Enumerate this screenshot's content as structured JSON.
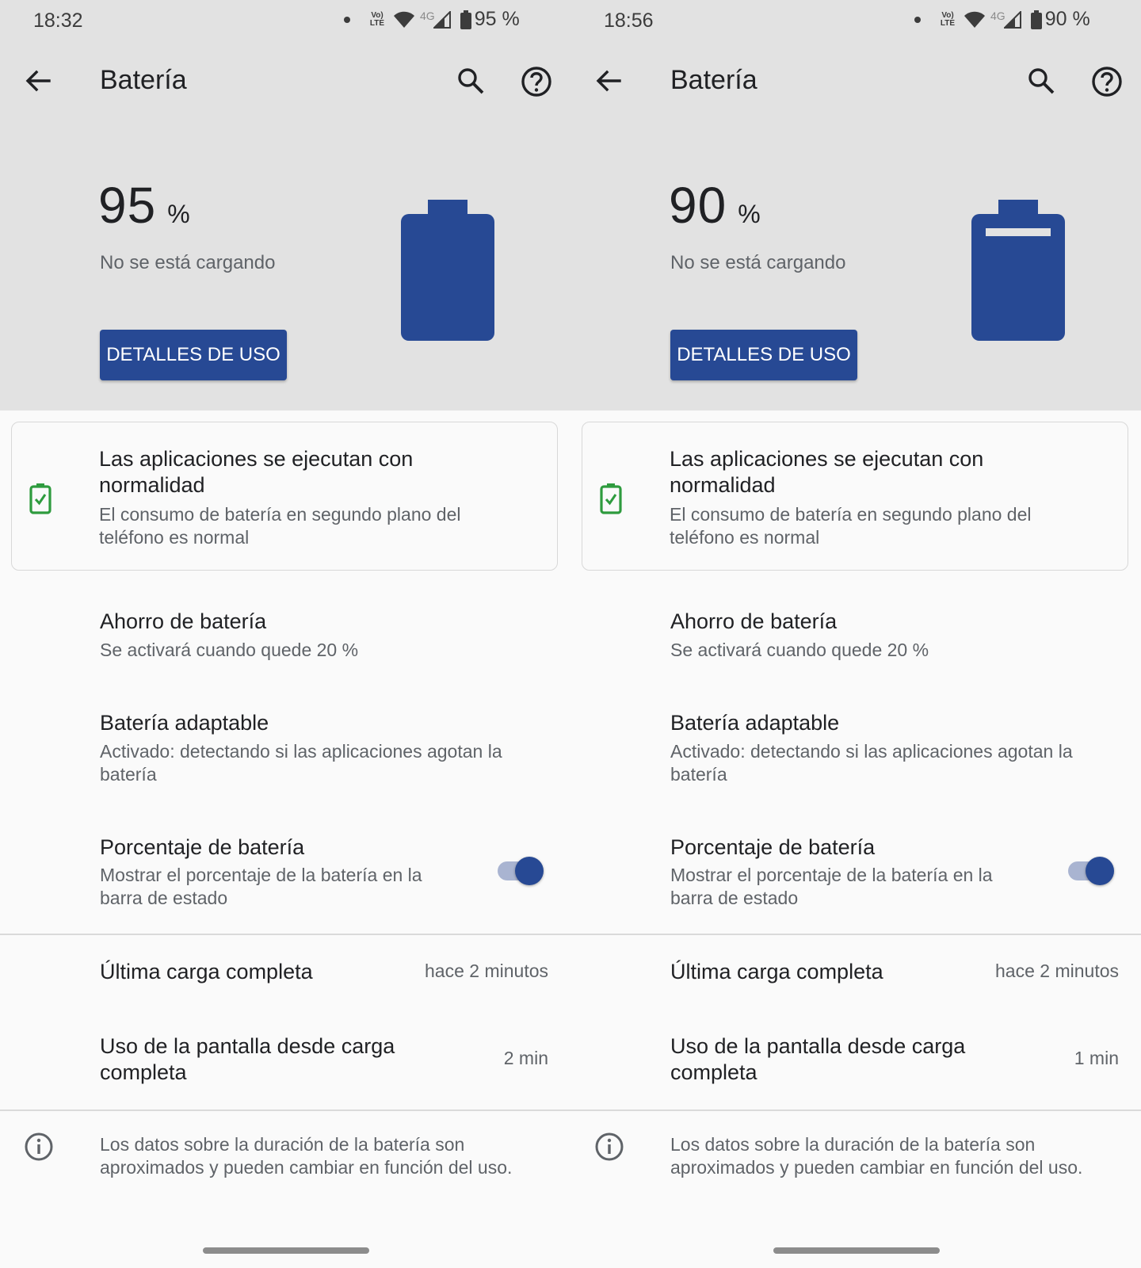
{
  "colors": {
    "accent": "#274994",
    "header_background": "#e2e2e2",
    "ok_green": "#2e9b3e"
  },
  "screens": [
    {
      "status": {
        "time": "18:32",
        "battery": "95 %"
      },
      "toolbar": {
        "title": "Batería",
        "back_icon": "arrow-back-icon",
        "search_icon": "search-icon",
        "help_icon": "help-icon"
      },
      "battery": {
        "percent": "95",
        "unit": "%",
        "state": "No se está cargando",
        "details_button": "DETALLES DE USO",
        "level": 0.95
      },
      "tip": {
        "title": "Las aplicaciones se ejecutan con normalidad",
        "summary": "El consumo de batería en segundo plano del teléfono es normal",
        "icon": "battery-check-icon"
      },
      "saver": {
        "title": "Ahorro de batería",
        "summary": "Se activará cuando quede 20 %"
      },
      "adaptive": {
        "title": "Batería adaptable",
        "summary": "Activado: detectando si las aplicaciones agotan la batería"
      },
      "percentage": {
        "title": "Porcentaje de batería",
        "summary": "Mostrar el porcentaje de la batería en la barra de estado",
        "enabled": true
      },
      "last_charge": {
        "label": "Última carga completa",
        "value": "hace 2 minutos"
      },
      "screen_usage": {
        "label": "Uso de la pantalla desde carga completa",
        "value": "2 min"
      },
      "footer": "Los datos sobre la duración de la batería son aproximados y pueden cambiar en función del uso."
    },
    {
      "status": {
        "time": "18:56",
        "battery": "90 %"
      },
      "toolbar": {
        "title": "Batería",
        "back_icon": "arrow-back-icon",
        "search_icon": "search-icon",
        "help_icon": "help-icon"
      },
      "battery": {
        "percent": "90",
        "unit": "%",
        "state": "No se está cargando",
        "details_button": "DETALLES DE USO",
        "level": 0.9
      },
      "tip": {
        "title": "Las aplicaciones se ejecutan con normalidad",
        "summary": "El consumo de batería en segundo plano del teléfono es normal",
        "icon": "battery-check-icon"
      },
      "saver": {
        "title": "Ahorro de batería",
        "summary": "Se activará cuando quede 20 %"
      },
      "adaptive": {
        "title": "Batería adaptable",
        "summary": "Activado: detectando si las aplicaciones agotan la batería"
      },
      "percentage": {
        "title": "Porcentaje de batería",
        "summary": "Mostrar el porcentaje de la batería en la barra de estado",
        "enabled": true
      },
      "last_charge": {
        "label": "Última carga completa",
        "value": "hace 2 minutos"
      },
      "screen_usage": {
        "label": "Uso de la pantalla desde carga completa",
        "value": "1 min"
      },
      "footer": "Los datos sobre la duración de la batería son aproximados y pueden cambiar en función del uso."
    }
  ]
}
